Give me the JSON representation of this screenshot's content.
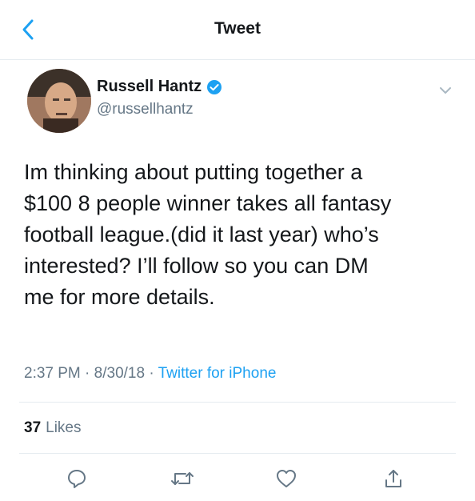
{
  "header": {
    "title": "Tweet",
    "back_icon": "chevron-left-icon"
  },
  "author": {
    "display_name": "Russell Hantz",
    "handle": "@russellhantz",
    "verified_icon": "verified-badge-icon",
    "menu_icon": "chevron-down-icon"
  },
  "tweet": {
    "text": "Im thinking about putting together a\n$100 8 people winner takes all fantasy\nfootball league.(did it last year) who’s\ninterested? I’ll follow so you can DM\nme for more details."
  },
  "meta": {
    "time": "2:37 PM",
    "date": "8/30/18",
    "separator": " · ",
    "source": "Twitter for iPhone"
  },
  "stats": {
    "likes_count": "37",
    "likes_label": "Likes"
  },
  "actions": {
    "reply_icon": "reply-icon",
    "retweet_icon": "retweet-icon",
    "like_icon": "heart-icon",
    "share_icon": "share-icon"
  },
  "colors": {
    "accent": "#1da1f2",
    "secondary_text": "#657786",
    "border": "#e6ecf0"
  }
}
